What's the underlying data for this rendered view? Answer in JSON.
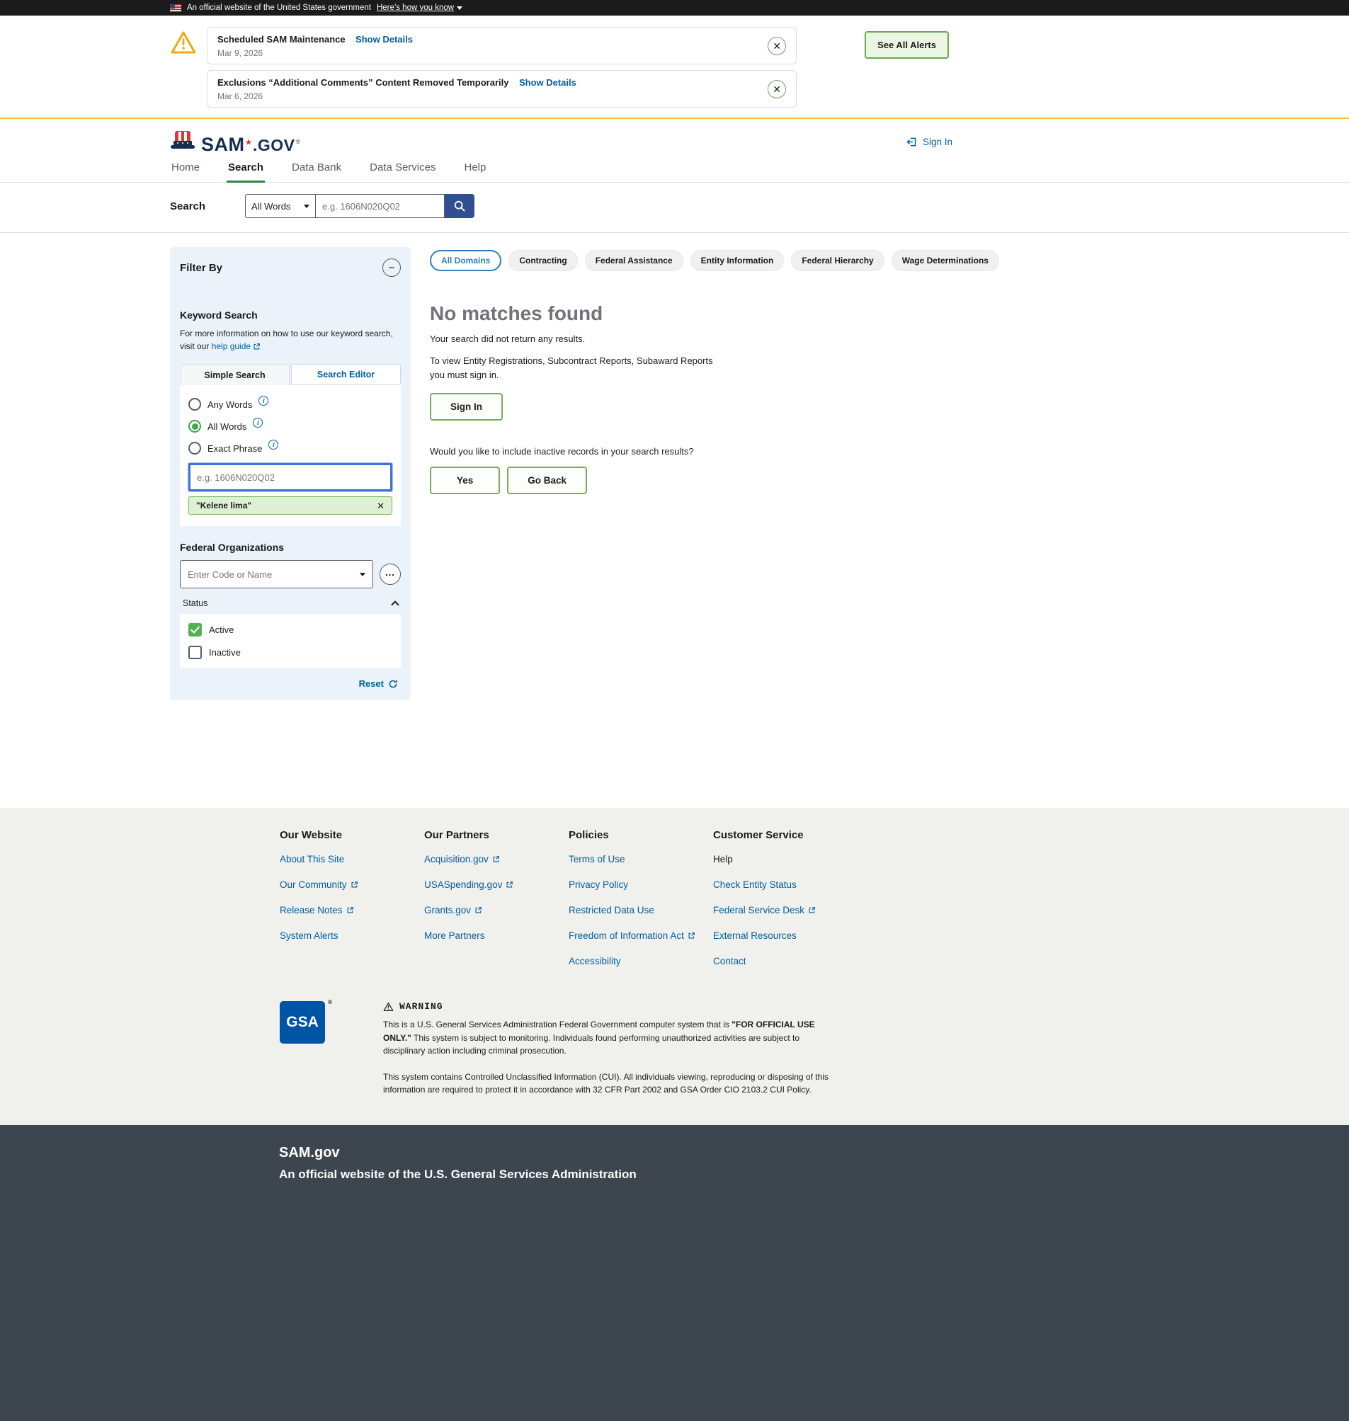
{
  "banner": {
    "text": "An official website of the United States government",
    "link_label": "Here’s how you know"
  },
  "alerts": {
    "see_all_label": "See All Alerts",
    "items": [
      {
        "title": "Scheduled SAM Maintenance",
        "details_label": "Show Details",
        "date": "Mar 9, 2026"
      },
      {
        "title": "Exclusions “Additional Comments” Content Removed Temporarily",
        "details_label": "Show Details",
        "date": "Mar 6, 2026"
      }
    ]
  },
  "header": {
    "brand_sam": "SAM",
    "brand_star": "★",
    "brand_gov": ".GOV",
    "brand_reg": "®",
    "sign_in_label": "Sign In",
    "nav": [
      {
        "label": "Home"
      },
      {
        "label": "Search"
      },
      {
        "label": "Data Bank"
      },
      {
        "label": "Data Services"
      },
      {
        "label": "Help"
      }
    ]
  },
  "search_bar": {
    "label": "Search",
    "mode_value": "All Words",
    "input_placeholder": "e.g. 1606N020Q02"
  },
  "filters": {
    "title": "Filter By",
    "keyword": {
      "title": "Keyword Search",
      "help_text": "For more information on how to use our keyword search, visit our",
      "help_link_label": "help guide",
      "tabs": [
        {
          "label": "Simple Search"
        },
        {
          "label": "Search Editor"
        }
      ],
      "radio_any": "Any Words",
      "radio_all": "All Words",
      "radio_exact": "Exact Phrase",
      "input_placeholder": "e.g. 1606N020Q02",
      "chip_label": "\"Kelene lima\""
    },
    "federal_organizations": {
      "title": "Federal Organizations",
      "combo_placeholder": "Enter Code or Name"
    },
    "status": {
      "title": "Status",
      "active_label": "Active",
      "inactive_label": "Inactive"
    },
    "reset_label": "Reset"
  },
  "results": {
    "domain_tabs": [
      {
        "label": "All Domains"
      },
      {
        "label": "Contracting"
      },
      {
        "label": "Federal Assistance"
      },
      {
        "label": "Entity Information"
      },
      {
        "label": "Federal Hierarchy"
      },
      {
        "label": "Wage Determinations"
      }
    ],
    "no_matches_title": "No matches found",
    "no_matches_sub": "Your search did not return any results.",
    "sign_in_hint": "To view Entity Registrations, Subcontract Reports, Subaward Reports you must sign in.",
    "sign_in_label": "Sign In",
    "inactive_question": "Would you like to include inactive records in your search results?",
    "yes_label": "Yes",
    "go_back_label": "Go Back"
  },
  "footer": {
    "columns": [
      {
        "title": "Our Website",
        "links": [
          {
            "label": "About This Site"
          },
          {
            "label": "Our Community"
          },
          {
            "label": "Release Notes"
          },
          {
            "label": "System Alerts"
          }
        ]
      },
      {
        "title": "Our Partners",
        "links": [
          {
            "label": "Acquisition.gov"
          },
          {
            "label": "USASpending.gov"
          },
          {
            "label": "Grants.gov"
          },
          {
            "label": "More Partners"
          }
        ]
      },
      {
        "title": "Policies",
        "links": [
          {
            "label": "Terms of Use"
          },
          {
            "label": "Privacy Policy"
          },
          {
            "label": "Restricted Data Use"
          },
          {
            "label": "Freedom of Information Act"
          },
          {
            "label": "Accessibility"
          }
        ]
      },
      {
        "title": "Customer Service",
        "links": [
          {
            "label": "Help"
          },
          {
            "label": "Check Entity Status"
          },
          {
            "label": "Federal Service Desk"
          },
          {
            "label": "External Resources"
          },
          {
            "label": "Contact"
          }
        ]
      }
    ],
    "gsa_label": "GSA",
    "gsa_reg": "®",
    "warning": {
      "title": "WARNING",
      "p1_a": "This is a U.S. General Services Administration Federal Government computer system that is ",
      "p1_bold": "\"FOR OFFICIAL USE ONLY.\"",
      "p1_b": " This system is subject to monitoring. Individuals found performing unauthorized activities are subject to disciplinary action including criminal prosecution.",
      "p2": "This system contains Controlled Unclassified Information (CUI). All individuals viewing, reproducing or disposing of this information are required to protect it in accordance with 32 CFR Part 2002 and GSA Order CIO 2103.2 CUI Policy."
    },
    "dark": {
      "title": "SAM.gov",
      "subtitle": "An official website of the U.S. General Services Administration"
    }
  },
  "colors": {
    "link_blue": "#005ea2",
    "accent_green": "#52b152",
    "alert_yellow": "#ffbe2e",
    "search_button_blue": "#324f92",
    "dark_footer": "#3d454e"
  }
}
